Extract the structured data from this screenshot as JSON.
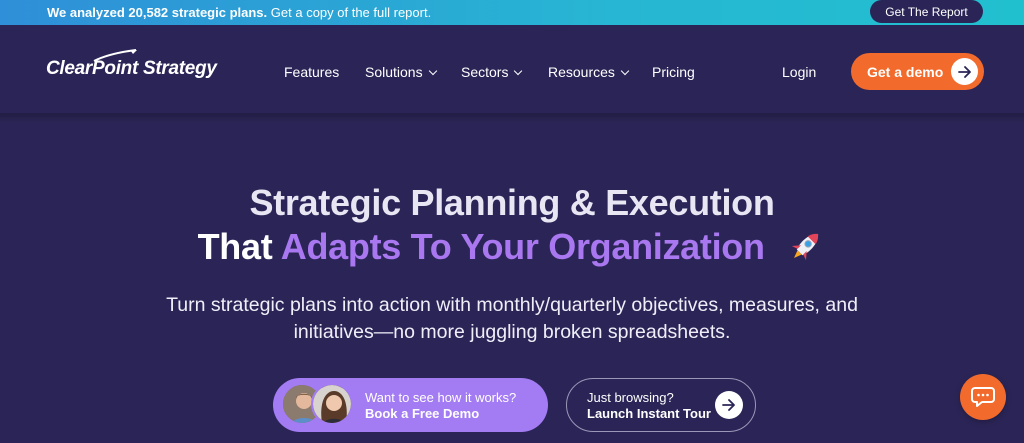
{
  "banner": {
    "bold_text": "We analyzed 20,582 strategic plans.",
    "text": "Get a copy of the full report.",
    "button_label": "Get The Report"
  },
  "nav": {
    "logo_text": "ClearPoint Strategy",
    "items": [
      {
        "label": "Features",
        "has_dropdown": false
      },
      {
        "label": "Solutions",
        "has_dropdown": true
      },
      {
        "label": "Sectors",
        "has_dropdown": true
      },
      {
        "label": "Resources",
        "has_dropdown": true
      },
      {
        "label": "Pricing",
        "has_dropdown": false
      }
    ],
    "login_label": "Login",
    "demo_label": "Get a demo"
  },
  "hero": {
    "line1": "Strategic Planning & Execution",
    "line2_white": "That",
    "line2_purple": "Adapts To Your Organization",
    "sub_line1": "Turn strategic plans into action with monthly/quarterly objectives, measures, and",
    "sub_line2": "initiatives—no more juggling broken spreadsheets."
  },
  "cta": {
    "primary_line1": "Want to see how it works?",
    "primary_line2": "Book a Free Demo",
    "secondary_line1": "Just browsing?",
    "secondary_line2": "Launch Instant Tour"
  },
  "colors": {
    "background": "#2b2557",
    "accent_orange": "#f26b2c",
    "accent_purple": "#a978f0",
    "banner_blue": "#27b6d3"
  },
  "icons": [
    "logo-swoosh-icon",
    "chevron-down-icon",
    "arrow-right-icon",
    "rocket-icon",
    "chat-icon"
  ]
}
